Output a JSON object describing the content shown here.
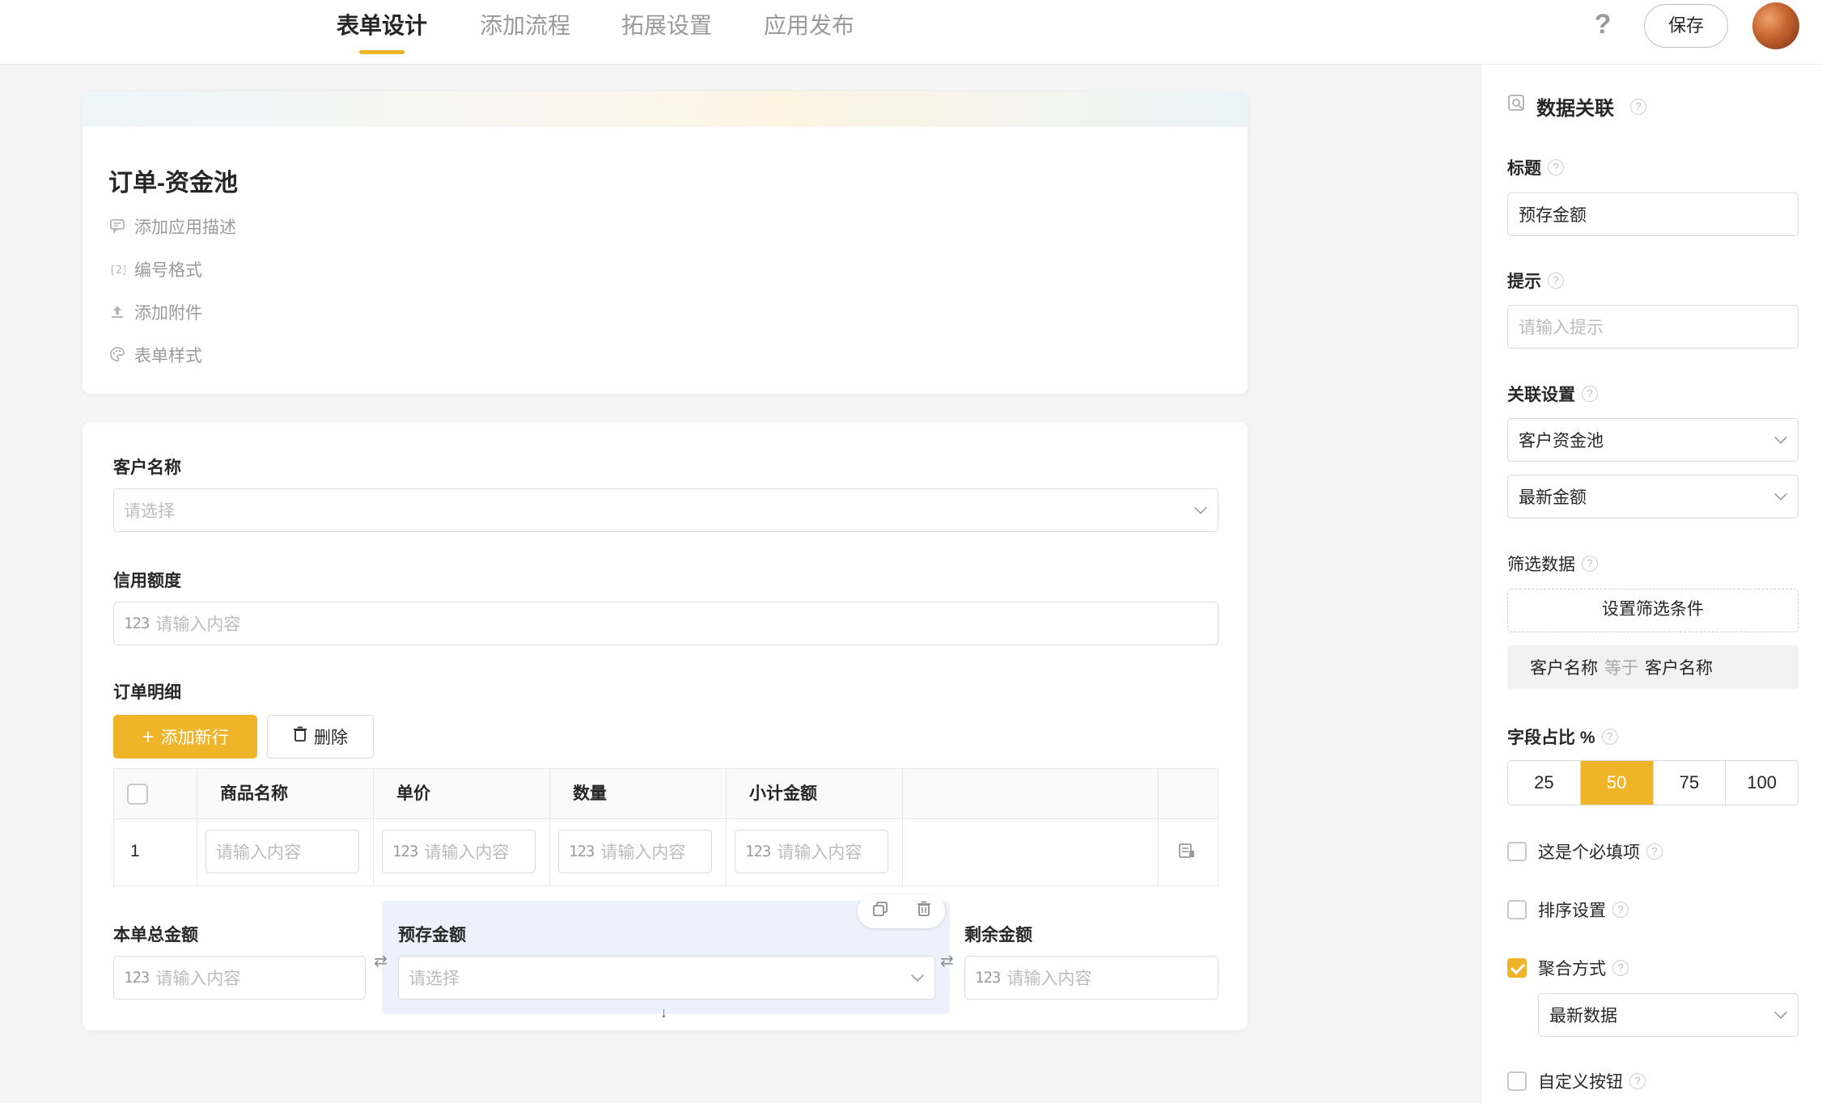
{
  "tabs": [
    {
      "label": "表单设计",
      "active": true
    },
    {
      "label": "添加流程",
      "active": false
    },
    {
      "label": "拓展设置",
      "active": false
    },
    {
      "label": "应用发布",
      "active": false
    }
  ],
  "header": {
    "help_icon": "?",
    "save_label": "保存"
  },
  "app": {
    "title": "订单-资金池",
    "links": [
      {
        "label": "添加应用描述",
        "icon": "comment-icon"
      },
      {
        "label": "编号格式",
        "icon": "number-format-icon"
      },
      {
        "label": "添加附件",
        "icon": "upload-icon"
      },
      {
        "label": "表单样式",
        "icon": "palette-icon"
      }
    ]
  },
  "form": {
    "customer": {
      "label": "客户名称",
      "placeholder": "请选择"
    },
    "credit": {
      "label": "信用额度",
      "placeholder": "请输入内容"
    },
    "order_detail": {
      "label": "订单明细",
      "add_row": "添加新行",
      "delete": "删除",
      "columns": [
        "商品名称",
        "单价",
        "数量",
        "小计金额"
      ],
      "rows": [
        {
          "index": "1",
          "placeholders": [
            "请输入内容",
            "请输入内容",
            "请输入内容",
            "请输入内容"
          ]
        }
      ]
    },
    "total": {
      "label": "本单总金额",
      "placeholder": "请输入内容"
    },
    "prepaid": {
      "label": "预存金额",
      "placeholder": "请选择"
    },
    "remaining": {
      "label": "剩余金额",
      "placeholder": "请输入内容"
    },
    "num_icon_text": "123"
  },
  "panel": {
    "header": "数据关联",
    "title_label": "标题",
    "title_value": "预存金额",
    "hint_label": "提示",
    "hint_placeholder": "请输入提示",
    "link_label": "关联设置",
    "link_source": "客户资金池",
    "link_field": "最新金额",
    "filter_label": "筛选数据",
    "filter_button": "设置筛选条件",
    "filter_condition": {
      "left": "客户名称",
      "op": "等于",
      "right": "客户名称"
    },
    "width_label": "字段占比 %",
    "width_options": [
      "25",
      "50",
      "75",
      "100"
    ],
    "width_selected": "50",
    "required_label": "这是个必填项",
    "required_checked": false,
    "sort_label": "排序设置",
    "sort_checked": false,
    "aggregate_label": "聚合方式",
    "aggregate_checked": true,
    "aggregate_value": "最新数据",
    "custom_button_label": "自定义按钮",
    "custom_button_checked": false
  },
  "colors": {
    "accent": "#f0b429",
    "selected_field_bg": "#edf1fb"
  }
}
